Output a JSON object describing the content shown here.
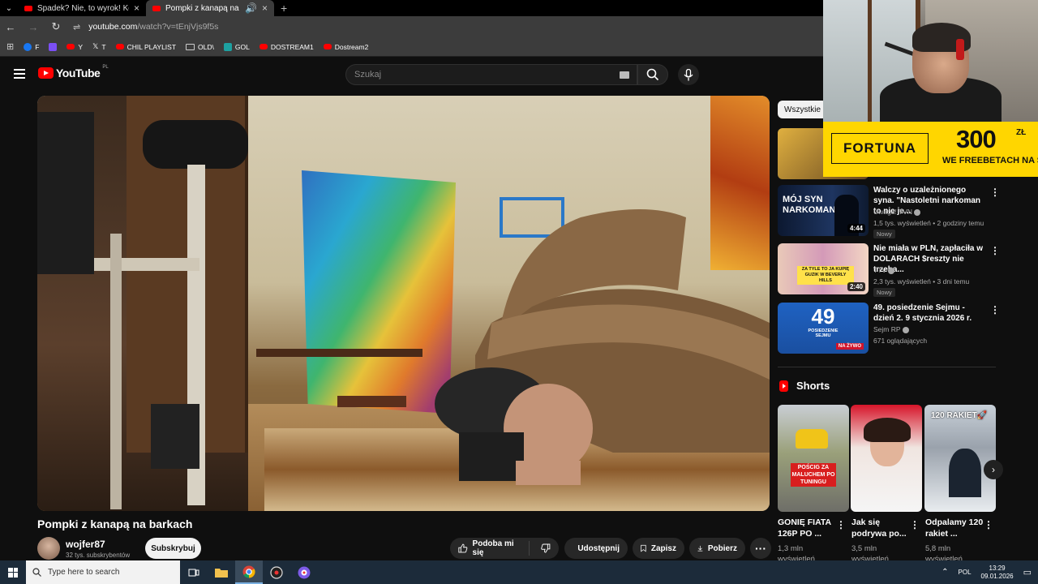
{
  "browser": {
    "tabs": [
      {
        "title": "Spadek? Nie, to wyrok! Kobieta",
        "active": false
      },
      {
        "title": "Pompki z kanapą na barkach",
        "active": true
      }
    ],
    "url_domain": "youtube.com",
    "url_path": "/watch?v=tEnjVjs9f5s",
    "bookmarks": [
      {
        "label": "F",
        "icon": "facebook-icon"
      },
      {
        "label": "",
        "icon": "twitch-icon"
      },
      {
        "label": "Y",
        "icon": "youtube-icon"
      },
      {
        "label": "T",
        "icon": "x-icon"
      },
      {
        "label": "CHIL PLAYLIST",
        "icon": "youtube-icon"
      },
      {
        "label": "OLD\\",
        "icon": "folder-icon"
      },
      {
        "label": "GOL",
        "icon": "gol-icon"
      },
      {
        "label": "DOSTREAM1",
        "icon": "youtube-icon"
      },
      {
        "label": "Dostream2",
        "icon": "youtube-icon"
      }
    ]
  },
  "youtube": {
    "logo_text": "YouTube",
    "logo_country": "PL",
    "search_placeholder": "Szukaj"
  },
  "video": {
    "title": "Pompki z kanapą na barkach",
    "channel": "wojfer87",
    "subscribers": "32 tys. subskrybentów",
    "subscribe_label": "Subskrybuj",
    "like_label": "Podoba mi się",
    "share_label": "Udostępnij",
    "save_label": "Zapisz",
    "download_label": "Pobierz"
  },
  "sidebar": {
    "chip": "Wszystkie",
    "recommendations": [
      {
        "title": "Walczy o uzależnionego syna. \"Nastoletni narkoman to nie je...",
        "channel": "Uwaga! TVN",
        "meta": "1,5 tys. wyświetleń • 2 godziny temu",
        "badge": "Nowy",
        "duration": "4:44",
        "thumb_text": "MÓJ SYN NARKOMAN"
      },
      {
        "title": "Nie miała w PLN, zapłaciła w DOLARACH $reszty nie trzeba...",
        "channel": "TTV",
        "meta": "2,3 tys. wyświetleń • 3 dni temu",
        "badge": "Nowy",
        "duration": "2:40",
        "thumb_text": "ZA TYLE TO JA KUPIĘ GUZIK W BEVERLY HILLS"
      },
      {
        "title": "49. posiedzenie Sejmu - dzień 2. 9 stycznia 2026 r.",
        "channel": "Sejm RP",
        "meta": "671 oglądających",
        "badge": "",
        "duration": "",
        "thumb_text": "49",
        "thumb_sub": "POSIEDZENIE SEJMU",
        "thumb_live": "NA ŻYWO"
      }
    ],
    "shorts_header": "Shorts",
    "shorts": [
      {
        "title": "GONIĘ FIATA 126P PO ...",
        "views": "1,3 mln",
        "views_unit": "wyświetleń",
        "thumb_text": "POŚCIG ZA MALUCHEM PO TUNINGU"
      },
      {
        "title": "Jak się podrywa po...",
        "views": "3,5 mln",
        "views_unit": "wyświetleń",
        "thumb_text": ""
      },
      {
        "title": "Odpalamy 120 rakiet ...",
        "views": "5,8 mln",
        "views_unit": "wyświetleń",
        "thumb_text": "120 RAKIET🚀"
      }
    ]
  },
  "overlay": {
    "sponsor_name": "FORTUNA",
    "sponsor_amount": "300",
    "sponsor_currency": "ZŁ",
    "sponsor_tagline": "WE FREEBETACH NA START"
  },
  "taskbar": {
    "search_placeholder": "Type here to search",
    "language": "POL",
    "time": "13:29",
    "date": "09.01.2026"
  },
  "colors": {
    "yt_red": "#ff0000",
    "fortuna_yellow": "#ffd600",
    "bg": "#0f0f0f"
  }
}
